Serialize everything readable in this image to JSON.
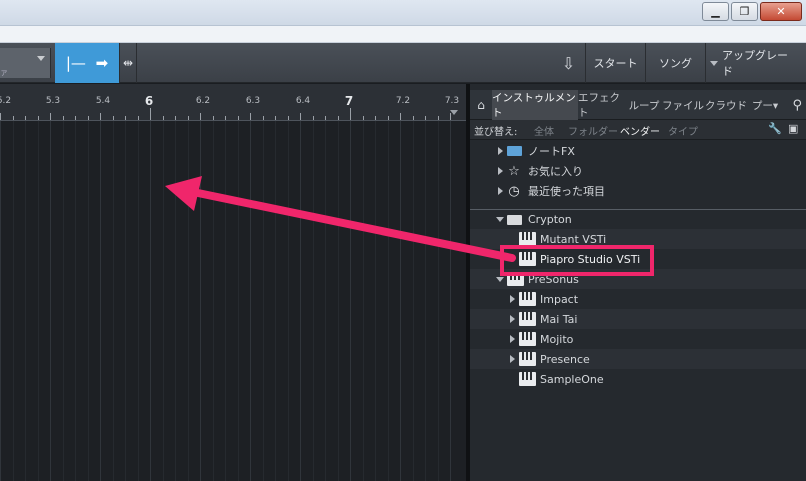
{
  "window": {
    "controls": [
      "minimize",
      "restore",
      "close"
    ],
    "minimize_glyph": "▁",
    "restore_glyph": "❐",
    "close_glyph": "✕"
  },
  "toolbar": {
    "combo_sub": "ァ",
    "start_label": "スタート",
    "song_label": "ソング",
    "upgrade_label": "アップグレード",
    "download_glyph": "⇩",
    "splitter_glyph": "⇹",
    "loop_start_glyph": "|—",
    "loop_arrow_glyph": "➡"
  },
  "ruler": {
    "labels": [
      "5.2",
      "5.3",
      "5.4",
      "6",
      "6.2",
      "6.3",
      "6.4",
      "7",
      "7.2",
      "7.3"
    ]
  },
  "browser": {
    "tabs": [
      "インストゥルメント",
      "エフェクト",
      "ループ",
      "ファイル",
      "クラウド",
      "プー▾"
    ],
    "active_tab": "インストゥルメント",
    "sort_label": "並び替え:",
    "sort_options": [
      "全体",
      "フォルダー",
      "ベンダー",
      "タイプ"
    ],
    "active_sort": "ベンダー",
    "tree": [
      {
        "label": "ノートFX",
        "icon": "folder-fx-icon",
        "expandable": true
      },
      {
        "label": "お気に入り",
        "icon": "star-icon",
        "expandable": true
      },
      {
        "label": "最近使った項目",
        "icon": "clock-icon",
        "expandable": true
      },
      {
        "label": "Crypton",
        "icon": "folder-open-icon",
        "expanded": true
      },
      {
        "label": "Mutant VSTi",
        "icon": "keyboard-icon"
      },
      {
        "label": "Piapro Studio VSTi",
        "icon": "vst-icon"
      },
      {
        "label": "PreSonus",
        "icon": "keyboard-icon",
        "expanded": true
      },
      {
        "label": "Impact",
        "icon": "keyboard-icon",
        "expandable": true
      },
      {
        "label": "Mai Tai",
        "icon": "keyboard-icon",
        "expandable": true
      },
      {
        "label": "Mojito",
        "icon": "keyboard-icon",
        "expandable": true
      },
      {
        "label": "Presence",
        "icon": "keyboard-icon",
        "expandable": true
      },
      {
        "label": "SampleOne",
        "icon": "keyboard-icon"
      }
    ]
  },
  "colors": {
    "accent_blue": "#3f9ad8",
    "highlight_pink": "#f0266b"
  }
}
